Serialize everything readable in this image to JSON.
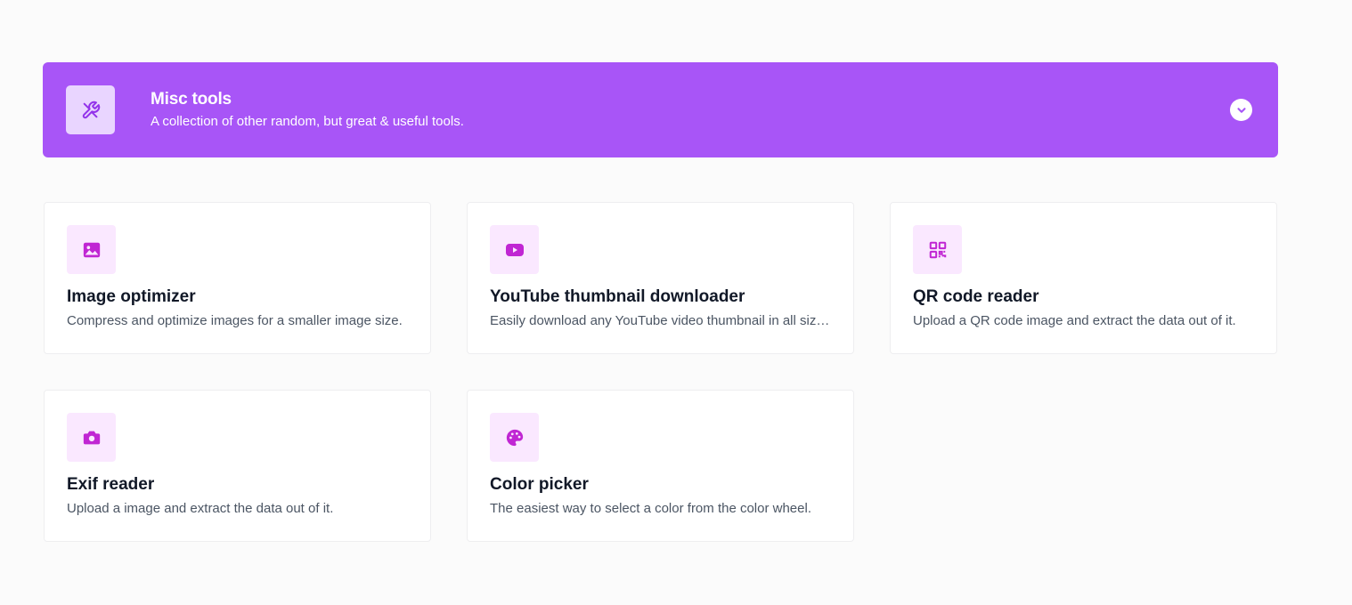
{
  "section": {
    "title": "Misc tools",
    "subtitle": "A collection of other random, but great & useful tools.",
    "icon": "tools-icon",
    "toggle_icon": "chevron-down-icon",
    "accent_color": "#a855f7"
  },
  "tools": [
    {
      "title": "Image optimizer",
      "description": "Compress and optimize images for a smaller image size.",
      "icon": "image-icon"
    },
    {
      "title": "YouTube thumbnail downloader",
      "description": "Easily download any YouTube video thumbnail in all sizes.",
      "icon": "youtube-icon"
    },
    {
      "title": "QR code reader",
      "description": "Upload a QR code image and extract the data out of it.",
      "icon": "qr-code-icon"
    },
    {
      "title": "Exif reader",
      "description": "Upload a image and extract the data out of it.",
      "icon": "camera-icon"
    },
    {
      "title": "Color picker",
      "description": "The easiest way to select a color from the color wheel.",
      "icon": "palette-icon"
    }
  ],
  "icon_color": "#c026d3"
}
